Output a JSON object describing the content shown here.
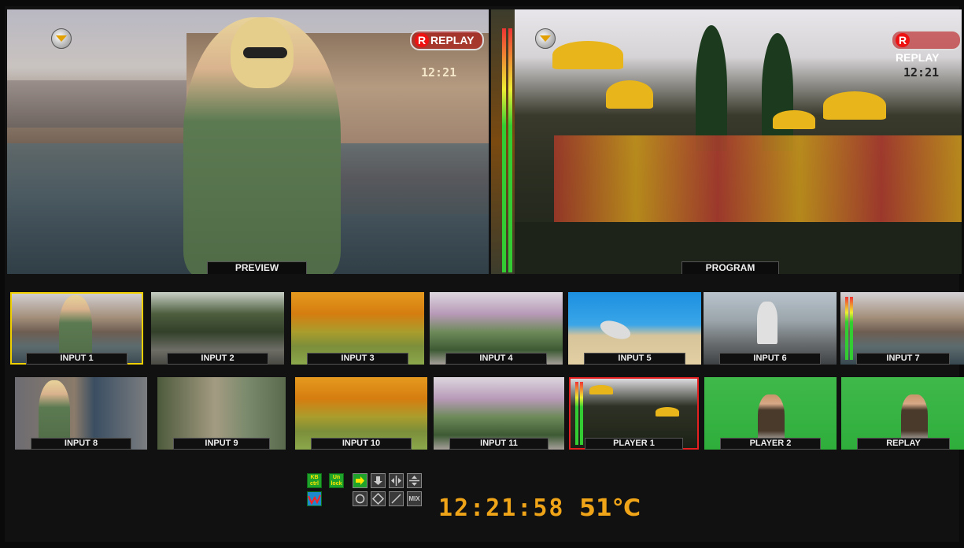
{
  "preview": {
    "label": "PREVIEW",
    "replay_badge": "REPLAY",
    "replay_icon": "R",
    "time_overlay": "12:21"
  },
  "program": {
    "label": "PROGRAM",
    "replay_badge": "REPLAY",
    "replay_icon": "R",
    "time_overlay": "12:21"
  },
  "inputs": [
    {
      "label": "INPUT 1",
      "selected": "yellow"
    },
    {
      "label": "INPUT 2"
    },
    {
      "label": "INPUT 3"
    },
    {
      "label": "INPUT 4"
    },
    {
      "label": "INPUT 5"
    },
    {
      "label": "INPUT 6"
    },
    {
      "label": "INPUT 7"
    },
    {
      "label": "INPUT 8"
    },
    {
      "label": "INPUT 9"
    },
    {
      "label": "INPUT 10"
    },
    {
      "label": "INPUT 11"
    },
    {
      "label": "PLAYER 1",
      "selected": "red"
    },
    {
      "label": "PLAYER 2"
    },
    {
      "label": "REPLAY"
    }
  ],
  "controls": {
    "kb_ctrl": "KB ctrl",
    "unlock": "Un lock",
    "mix": "MIX",
    "transition_icons": [
      "arrow-right-icon",
      "arrow-down-icon",
      "split-horizontal-icon",
      "split-vertical-icon",
      "circle-wipe-icon",
      "diamond-wipe-icon",
      "diagonal-wipe-icon",
      "mix-icon"
    ],
    "audio_icon": "waveform-icon"
  },
  "status": {
    "clock": "12:21:58",
    "temperature": "51℃"
  },
  "colors": {
    "clock": "#f0a418",
    "preview_select": "#f0d000",
    "program_select": "#e42020",
    "control_green": "#1fa32a"
  }
}
